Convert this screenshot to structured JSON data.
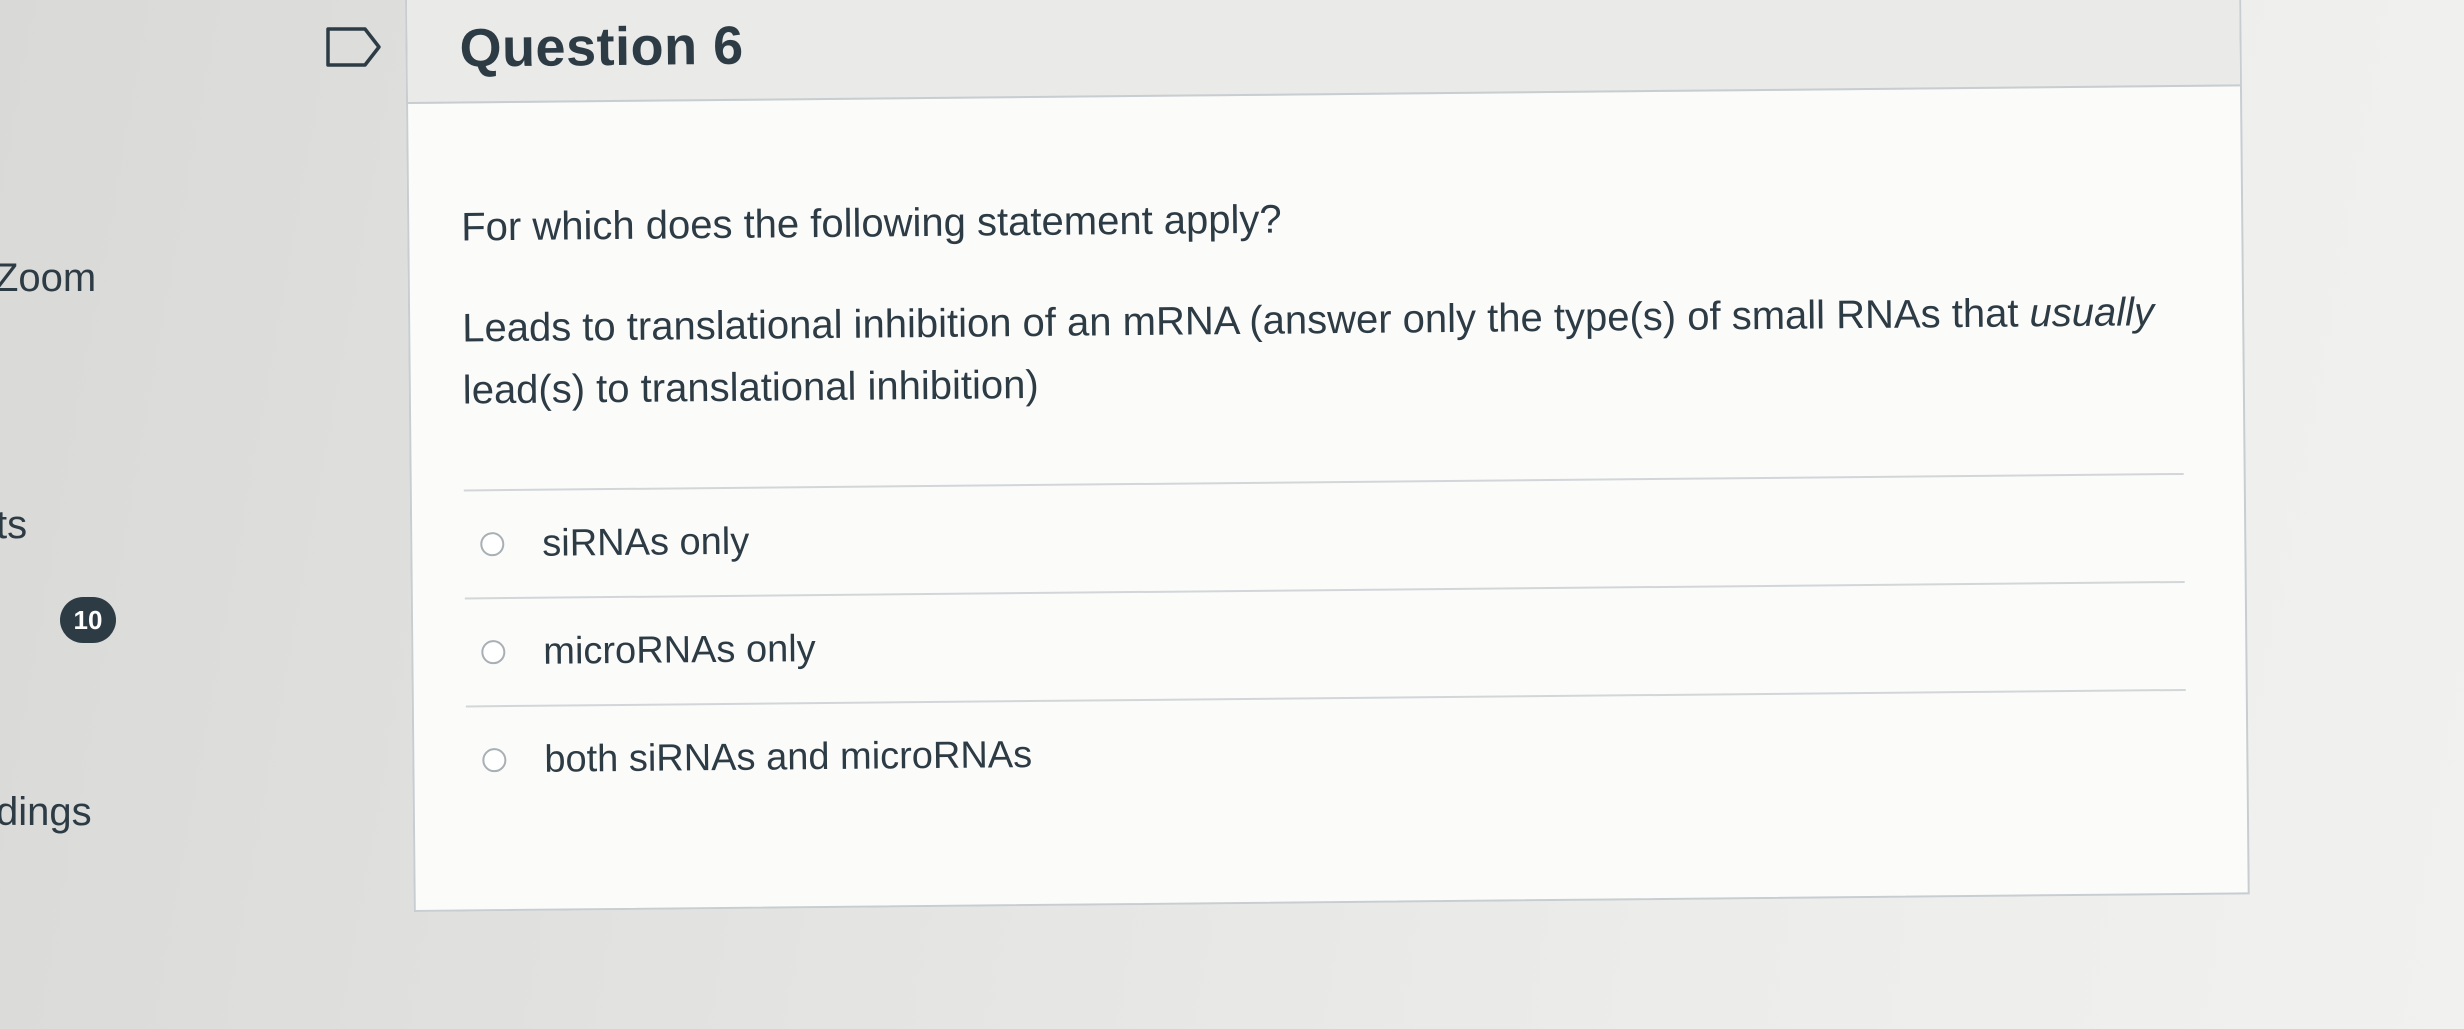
{
  "nav": {
    "zoom_label": "Zoom",
    "points_label": "ts",
    "badge_count": "10",
    "recordings_label": "dings"
  },
  "question": {
    "title": "Question 6",
    "prompt": "For which does the following statement apply?",
    "statement_part1": "Leads to translational inhibition of an mRNA  (answer only the type(s) of small RNAs that ",
    "statement_emphasis": "usually",
    "statement_part2": " lead(s) to translational inhibition)",
    "answers": [
      {
        "label": "siRNAs only",
        "selected": false
      },
      {
        "label": "microRNAs only",
        "selected": false
      },
      {
        "label": "both siRNAs and microRNAs",
        "selected": false
      }
    ]
  },
  "icons": {
    "flag": "flag-icon"
  },
  "colors": {
    "text": "#2d3b45",
    "badge_bg": "#2d3b45",
    "card_border": "#c7cdd1"
  }
}
